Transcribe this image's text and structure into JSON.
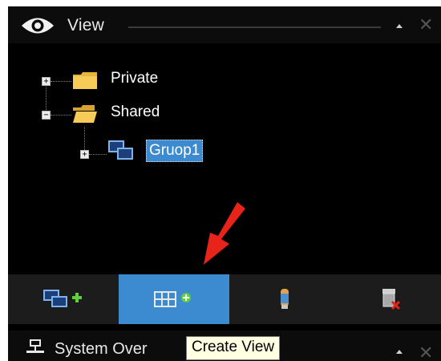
{
  "header": {
    "title": "View"
  },
  "tree": {
    "items": [
      {
        "label": "Private",
        "expander": "+"
      },
      {
        "label": "Shared",
        "expander": "−"
      },
      {
        "label": "Gruop1",
        "expander": "+"
      }
    ]
  },
  "toolbar": {
    "buttons": [
      {
        "name": "add-group"
      },
      {
        "name": "create-view",
        "active": true
      },
      {
        "name": "edit"
      },
      {
        "name": "delete"
      }
    ]
  },
  "bottom_panel": {
    "title": "System Over"
  },
  "tooltip": {
    "text": "Create View"
  },
  "colors": {
    "accent": "#3c8bd1",
    "panel_bg": "#000000",
    "toolbar_bg": "#1c1c1c",
    "arrow": "#e8241a"
  }
}
